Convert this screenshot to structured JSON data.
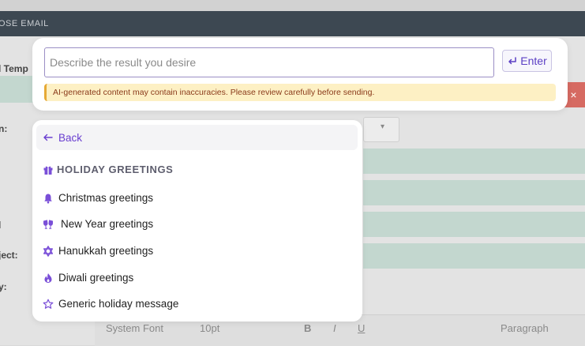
{
  "background": {
    "title": "OSE EMAIL",
    "label_template": "l Temp",
    "label_from": "n:",
    "label_l": "l",
    "label_subject": "ject:",
    "label_y": "y:",
    "toolbar": {
      "font": "System Font",
      "size": "10pt",
      "bold": "B",
      "italic": "I",
      "underline": "U",
      "paragraph": "Paragraph"
    },
    "close_glyph": "×"
  },
  "prompt": {
    "placeholder": "Describe the result you desire",
    "value": "",
    "enter_label": "Enter",
    "enter_icon": "return-arrow-icon",
    "warning": "AI-generated content may contain inaccuracies. Please review carefully before sending."
  },
  "menu": {
    "back_label": "Back",
    "back_icon": "left-arrow-icon",
    "section": {
      "title": "HOLIDAY GREETINGS",
      "icon": "gift-icon"
    },
    "items": [
      {
        "label": "Christmas greetings",
        "icon": "bell-icon"
      },
      {
        "label": "New Year greetings",
        "icon": "glasses-cheers-icon"
      },
      {
        "label": "Hanukkah greetings",
        "icon": "star-of-david-icon"
      },
      {
        "label": "Diwali greetings",
        "icon": "flame-icon"
      },
      {
        "label": "Generic holiday message",
        "icon": "star-outline-icon"
      }
    ]
  },
  "colors": {
    "accent": "#6a3fd0",
    "warning_bg": "#fdf0c4",
    "warning_border": "#e6a935"
  }
}
